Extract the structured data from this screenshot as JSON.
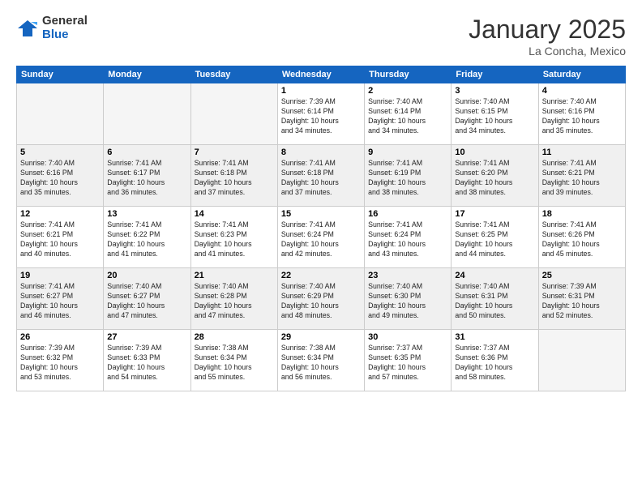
{
  "header": {
    "logo_general": "General",
    "logo_blue": "Blue",
    "month_title": "January 2025",
    "subtitle": "La Concha, Mexico"
  },
  "days_of_week": [
    "Sunday",
    "Monday",
    "Tuesday",
    "Wednesday",
    "Thursday",
    "Friday",
    "Saturday"
  ],
  "weeks": [
    [
      {
        "day": "",
        "info": ""
      },
      {
        "day": "",
        "info": ""
      },
      {
        "day": "",
        "info": ""
      },
      {
        "day": "1",
        "info": "Sunrise: 7:39 AM\nSunset: 6:14 PM\nDaylight: 10 hours\nand 34 minutes."
      },
      {
        "day": "2",
        "info": "Sunrise: 7:40 AM\nSunset: 6:14 PM\nDaylight: 10 hours\nand 34 minutes."
      },
      {
        "day": "3",
        "info": "Sunrise: 7:40 AM\nSunset: 6:15 PM\nDaylight: 10 hours\nand 34 minutes."
      },
      {
        "day": "4",
        "info": "Sunrise: 7:40 AM\nSunset: 6:16 PM\nDaylight: 10 hours\nand 35 minutes."
      }
    ],
    [
      {
        "day": "5",
        "info": "Sunrise: 7:40 AM\nSunset: 6:16 PM\nDaylight: 10 hours\nand 35 minutes."
      },
      {
        "day": "6",
        "info": "Sunrise: 7:41 AM\nSunset: 6:17 PM\nDaylight: 10 hours\nand 36 minutes."
      },
      {
        "day": "7",
        "info": "Sunrise: 7:41 AM\nSunset: 6:18 PM\nDaylight: 10 hours\nand 37 minutes."
      },
      {
        "day": "8",
        "info": "Sunrise: 7:41 AM\nSunset: 6:18 PM\nDaylight: 10 hours\nand 37 minutes."
      },
      {
        "day": "9",
        "info": "Sunrise: 7:41 AM\nSunset: 6:19 PM\nDaylight: 10 hours\nand 38 minutes."
      },
      {
        "day": "10",
        "info": "Sunrise: 7:41 AM\nSunset: 6:20 PM\nDaylight: 10 hours\nand 38 minutes."
      },
      {
        "day": "11",
        "info": "Sunrise: 7:41 AM\nSunset: 6:21 PM\nDaylight: 10 hours\nand 39 minutes."
      }
    ],
    [
      {
        "day": "12",
        "info": "Sunrise: 7:41 AM\nSunset: 6:21 PM\nDaylight: 10 hours\nand 40 minutes."
      },
      {
        "day": "13",
        "info": "Sunrise: 7:41 AM\nSunset: 6:22 PM\nDaylight: 10 hours\nand 41 minutes."
      },
      {
        "day": "14",
        "info": "Sunrise: 7:41 AM\nSunset: 6:23 PM\nDaylight: 10 hours\nand 41 minutes."
      },
      {
        "day": "15",
        "info": "Sunrise: 7:41 AM\nSunset: 6:24 PM\nDaylight: 10 hours\nand 42 minutes."
      },
      {
        "day": "16",
        "info": "Sunrise: 7:41 AM\nSunset: 6:24 PM\nDaylight: 10 hours\nand 43 minutes."
      },
      {
        "day": "17",
        "info": "Sunrise: 7:41 AM\nSunset: 6:25 PM\nDaylight: 10 hours\nand 44 minutes."
      },
      {
        "day": "18",
        "info": "Sunrise: 7:41 AM\nSunset: 6:26 PM\nDaylight: 10 hours\nand 45 minutes."
      }
    ],
    [
      {
        "day": "19",
        "info": "Sunrise: 7:41 AM\nSunset: 6:27 PM\nDaylight: 10 hours\nand 46 minutes."
      },
      {
        "day": "20",
        "info": "Sunrise: 7:40 AM\nSunset: 6:27 PM\nDaylight: 10 hours\nand 47 minutes."
      },
      {
        "day": "21",
        "info": "Sunrise: 7:40 AM\nSunset: 6:28 PM\nDaylight: 10 hours\nand 47 minutes."
      },
      {
        "day": "22",
        "info": "Sunrise: 7:40 AM\nSunset: 6:29 PM\nDaylight: 10 hours\nand 48 minutes."
      },
      {
        "day": "23",
        "info": "Sunrise: 7:40 AM\nSunset: 6:30 PM\nDaylight: 10 hours\nand 49 minutes."
      },
      {
        "day": "24",
        "info": "Sunrise: 7:40 AM\nSunset: 6:31 PM\nDaylight: 10 hours\nand 50 minutes."
      },
      {
        "day": "25",
        "info": "Sunrise: 7:39 AM\nSunset: 6:31 PM\nDaylight: 10 hours\nand 52 minutes."
      }
    ],
    [
      {
        "day": "26",
        "info": "Sunrise: 7:39 AM\nSunset: 6:32 PM\nDaylight: 10 hours\nand 53 minutes."
      },
      {
        "day": "27",
        "info": "Sunrise: 7:39 AM\nSunset: 6:33 PM\nDaylight: 10 hours\nand 54 minutes."
      },
      {
        "day": "28",
        "info": "Sunrise: 7:38 AM\nSunset: 6:34 PM\nDaylight: 10 hours\nand 55 minutes."
      },
      {
        "day": "29",
        "info": "Sunrise: 7:38 AM\nSunset: 6:34 PM\nDaylight: 10 hours\nand 56 minutes."
      },
      {
        "day": "30",
        "info": "Sunrise: 7:37 AM\nSunset: 6:35 PM\nDaylight: 10 hours\nand 57 minutes."
      },
      {
        "day": "31",
        "info": "Sunrise: 7:37 AM\nSunset: 6:36 PM\nDaylight: 10 hours\nand 58 minutes."
      },
      {
        "day": "",
        "info": ""
      }
    ]
  ]
}
